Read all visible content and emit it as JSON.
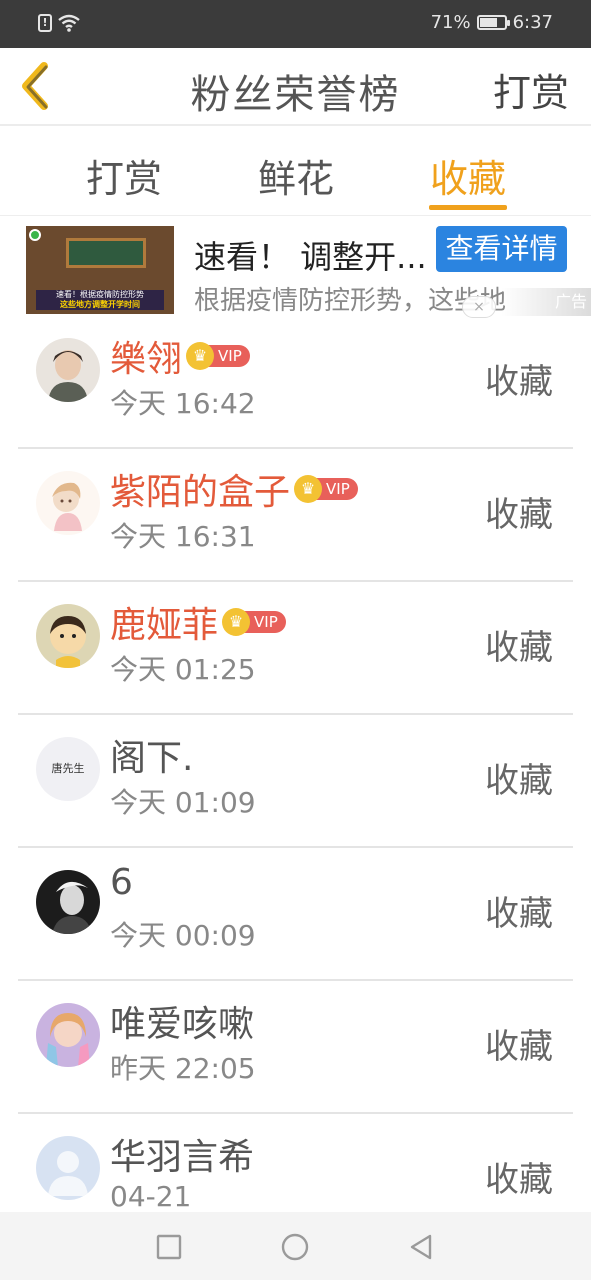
{
  "status_bar": {
    "alert_icon": "alert-icon",
    "wifi_icon": "wifi-icon",
    "battery_percent": "71%",
    "battery_level": 0.71,
    "time": "6:37"
  },
  "header": {
    "back_icon": "chevron-left-icon",
    "title": "粉丝荣誉榜",
    "right_action": "打赏",
    "back_color": "#f0b81c"
  },
  "tabs": {
    "items": [
      {
        "label": "打赏",
        "active": false
      },
      {
        "label": "鲜花",
        "active": false
      },
      {
        "label": "收藏",
        "active": true
      }
    ],
    "active_color": "#f0a11c"
  },
  "ad": {
    "thumbnail_line1": "速看！根据疫情防控形势",
    "thumbnail_line2": "这些地方调整开学时间",
    "title": "速看！ 调整开...",
    "button": "查看详情",
    "description": "根据疫情防控形势，这些地",
    "close": "×",
    "tag": "广告"
  },
  "list": {
    "rows": [
      {
        "name": "樂翎",
        "vip": true,
        "time": "今天 16:42",
        "action": "收藏"
      },
      {
        "name": "紫陌的盒子",
        "vip": true,
        "time": "今天 16:31",
        "action": "收藏"
      },
      {
        "name": "鹿娅菲",
        "vip": true,
        "time": "今天 01:25",
        "action": "收藏"
      },
      {
        "name": "阁下.",
        "vip": false,
        "time": "今天 01:09",
        "action": "收藏",
        "avatar_text": "唐先生"
      },
      {
        "name": "6",
        "vip": false,
        "time": "今天 00:09",
        "action": "收藏"
      },
      {
        "name": "唯爱咳嗽",
        "vip": false,
        "time": "昨天 22:05",
        "action": "收藏"
      },
      {
        "name": "华羽言希",
        "vip": false,
        "time": "04-21",
        "action": "收藏"
      }
    ],
    "vip_label": "VIP",
    "vip_name_color": "#e35a3a"
  },
  "nav_bar": {
    "recent_icon": "square-icon",
    "home_icon": "circle-icon",
    "back_icon": "triangle-back-icon"
  }
}
